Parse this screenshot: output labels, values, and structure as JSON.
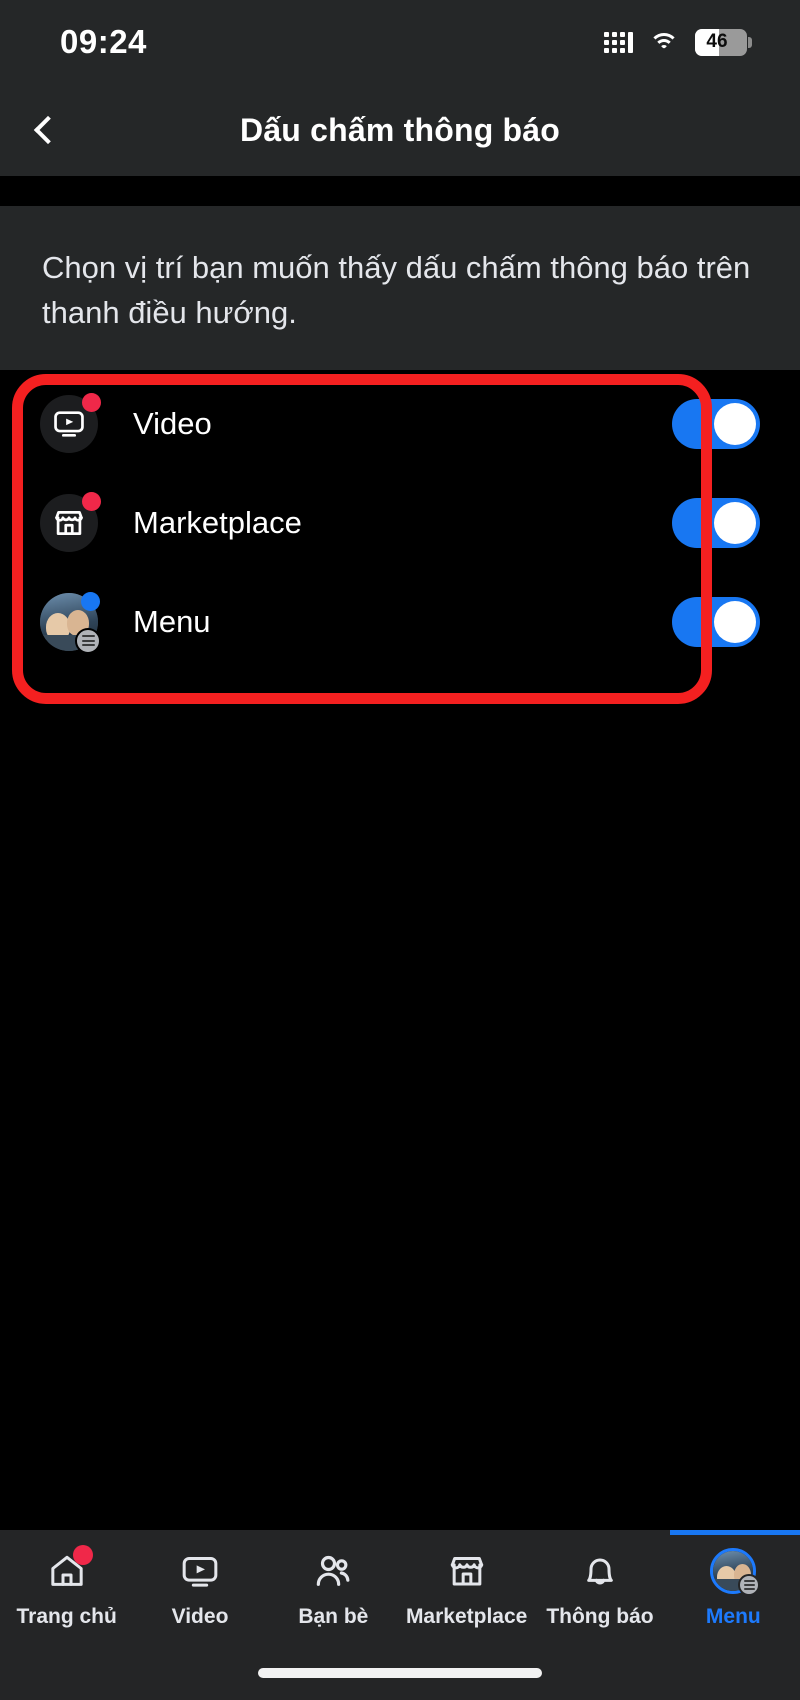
{
  "status_bar": {
    "time": "09:24",
    "signal_icon": "signal-bars-icon",
    "wifi_icon": "wifi-icon",
    "battery_percent": "46",
    "battery_level": 46,
    "battery_icon": "battery-icon"
  },
  "header": {
    "back_icon": "chevron-left-icon",
    "title": "Dấu chấm thông báo"
  },
  "description": {
    "text": "Chọn vị trí bạn muốn thấy dấu chấm thông báo trên thanh điều hướng."
  },
  "settings_list": {
    "rows": [
      {
        "label": "Video",
        "icon": "video-icon",
        "badge": "red-dot-badge",
        "toggle_on": true
      },
      {
        "label": "Marketplace",
        "icon": "marketplace-store-icon",
        "badge": "red-dot-badge",
        "toggle_on": true
      },
      {
        "label": "Menu",
        "icon": "profile-avatar-icon",
        "badge": "blue-dot-badge",
        "toggle_on": true
      }
    ]
  },
  "annotation": {
    "type": "red-highlight-box",
    "color": "#f42020"
  },
  "bottom_nav": {
    "active": "Menu",
    "active_color": "#1d7afc",
    "items": [
      {
        "label": "Trang chủ",
        "icon": "home-icon",
        "badge": true,
        "active": false
      },
      {
        "label": "Video",
        "icon": "video-icon",
        "badge": false,
        "active": false
      },
      {
        "label": "Bạn bè",
        "icon": "friends-icon",
        "badge": false,
        "active": false
      },
      {
        "label": "Marketplace",
        "icon": "marketplace-icon",
        "badge": false,
        "active": false
      },
      {
        "label": "Thông báo",
        "icon": "bell-icon",
        "badge": false,
        "active": false
      },
      {
        "label": "Menu",
        "icon": "avatar-menu-icon",
        "badge": false,
        "active": true
      }
    ]
  },
  "home_indicator": "home-indicator-bar"
}
